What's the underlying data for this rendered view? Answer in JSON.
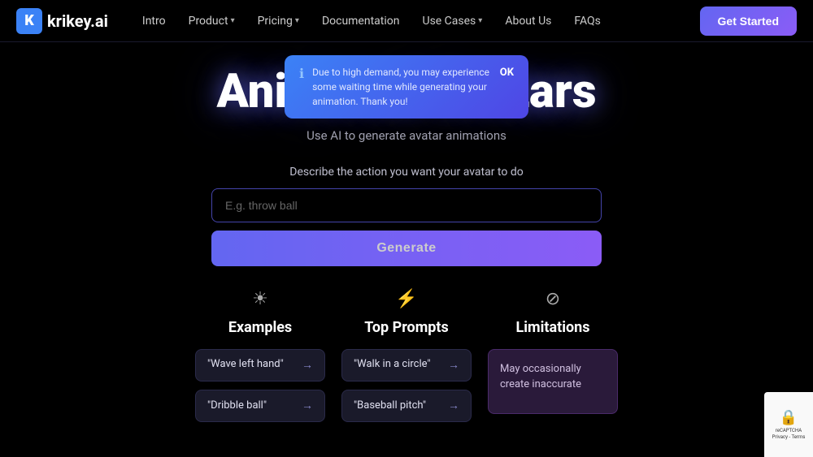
{
  "navbar": {
    "logo_text": "krikey.ai",
    "logo_char": "K",
    "links": [
      {
        "label": "Intro",
        "has_dropdown": false
      },
      {
        "label": "Product",
        "has_dropdown": true
      },
      {
        "label": "Pricing",
        "has_dropdown": true
      },
      {
        "label": "Documentation",
        "has_dropdown": false
      },
      {
        "label": "Use Cases",
        "has_dropdown": true
      },
      {
        "label": "About Us",
        "has_dropdown": false
      },
      {
        "label": "FAQs",
        "has_dropdown": false
      }
    ],
    "cta_label": "Get Started"
  },
  "notification": {
    "message": "Due to high demand, you may experience some waiting time while generating your animation. Thank you!",
    "ok_label": "OK"
  },
  "hero": {
    "title": "Animated Avatars",
    "subtitle": "Use AI to generate avatar animations",
    "action_label": "Describe the action you want your avatar to do",
    "input_placeholder": "E.g. throw ball",
    "generate_label": "Generate"
  },
  "sections": {
    "examples": {
      "label": "Examples",
      "icon": "☀",
      "items": [
        {
          "text": "\"Wave left hand\""
        },
        {
          "text": "\"Dribble ball\""
        }
      ]
    },
    "top_prompts": {
      "label": "Top Prompts",
      "icon": "⚡",
      "items": [
        {
          "text": "\"Walk in a circle\""
        },
        {
          "text": "\"Baseball pitch\""
        }
      ]
    },
    "limitations": {
      "label": "Limitations",
      "icon": "⊘",
      "text": "May occasionally create inaccurate"
    }
  }
}
